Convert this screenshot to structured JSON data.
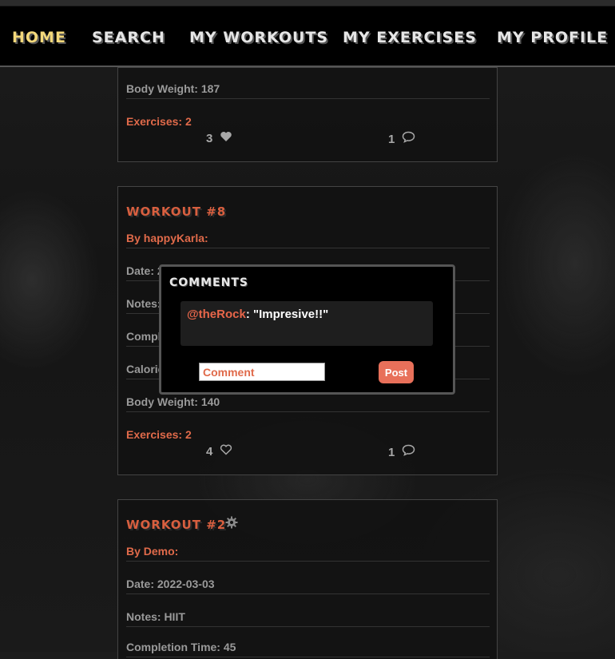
{
  "nav": {
    "home": "Home",
    "search": "Search",
    "my_workouts": "My Workouts",
    "my_exercises": "My Exercises",
    "my_profile": "My Profile"
  },
  "workout_top": {
    "body_weight": "Body Weight: 187",
    "exercises": "Exercises: 2",
    "likes": "3",
    "comments": "1"
  },
  "workout_8": {
    "title": "Workout #8",
    "by": "By happyKarla:",
    "date": "Date: 2",
    "notes": "Notes:",
    "completion": "Comple",
    "calories": "Calorie",
    "body_weight": "Body Weight: 140",
    "exercises": "Exercises: 2",
    "likes": "4",
    "comments": "1"
  },
  "workout_2": {
    "title": "Workout #2",
    "by": "By Demo:",
    "date": "Date: 2022-03-03",
    "notes": "Notes: HIIT",
    "completion": "Completion Time: 45"
  },
  "modal": {
    "title": "Comments",
    "comment_user": "@theRock",
    "comment_text": ": \"Impresive!!\"",
    "input_placeholder": "Comment",
    "post_label": "Post"
  },
  "colors": {
    "accent": "#e06a4a",
    "active_nav": "#f3d87a"
  },
  "icons": [
    "heart-filled-icon",
    "heart-outline-icon",
    "comment-icon",
    "gear-icon"
  ]
}
